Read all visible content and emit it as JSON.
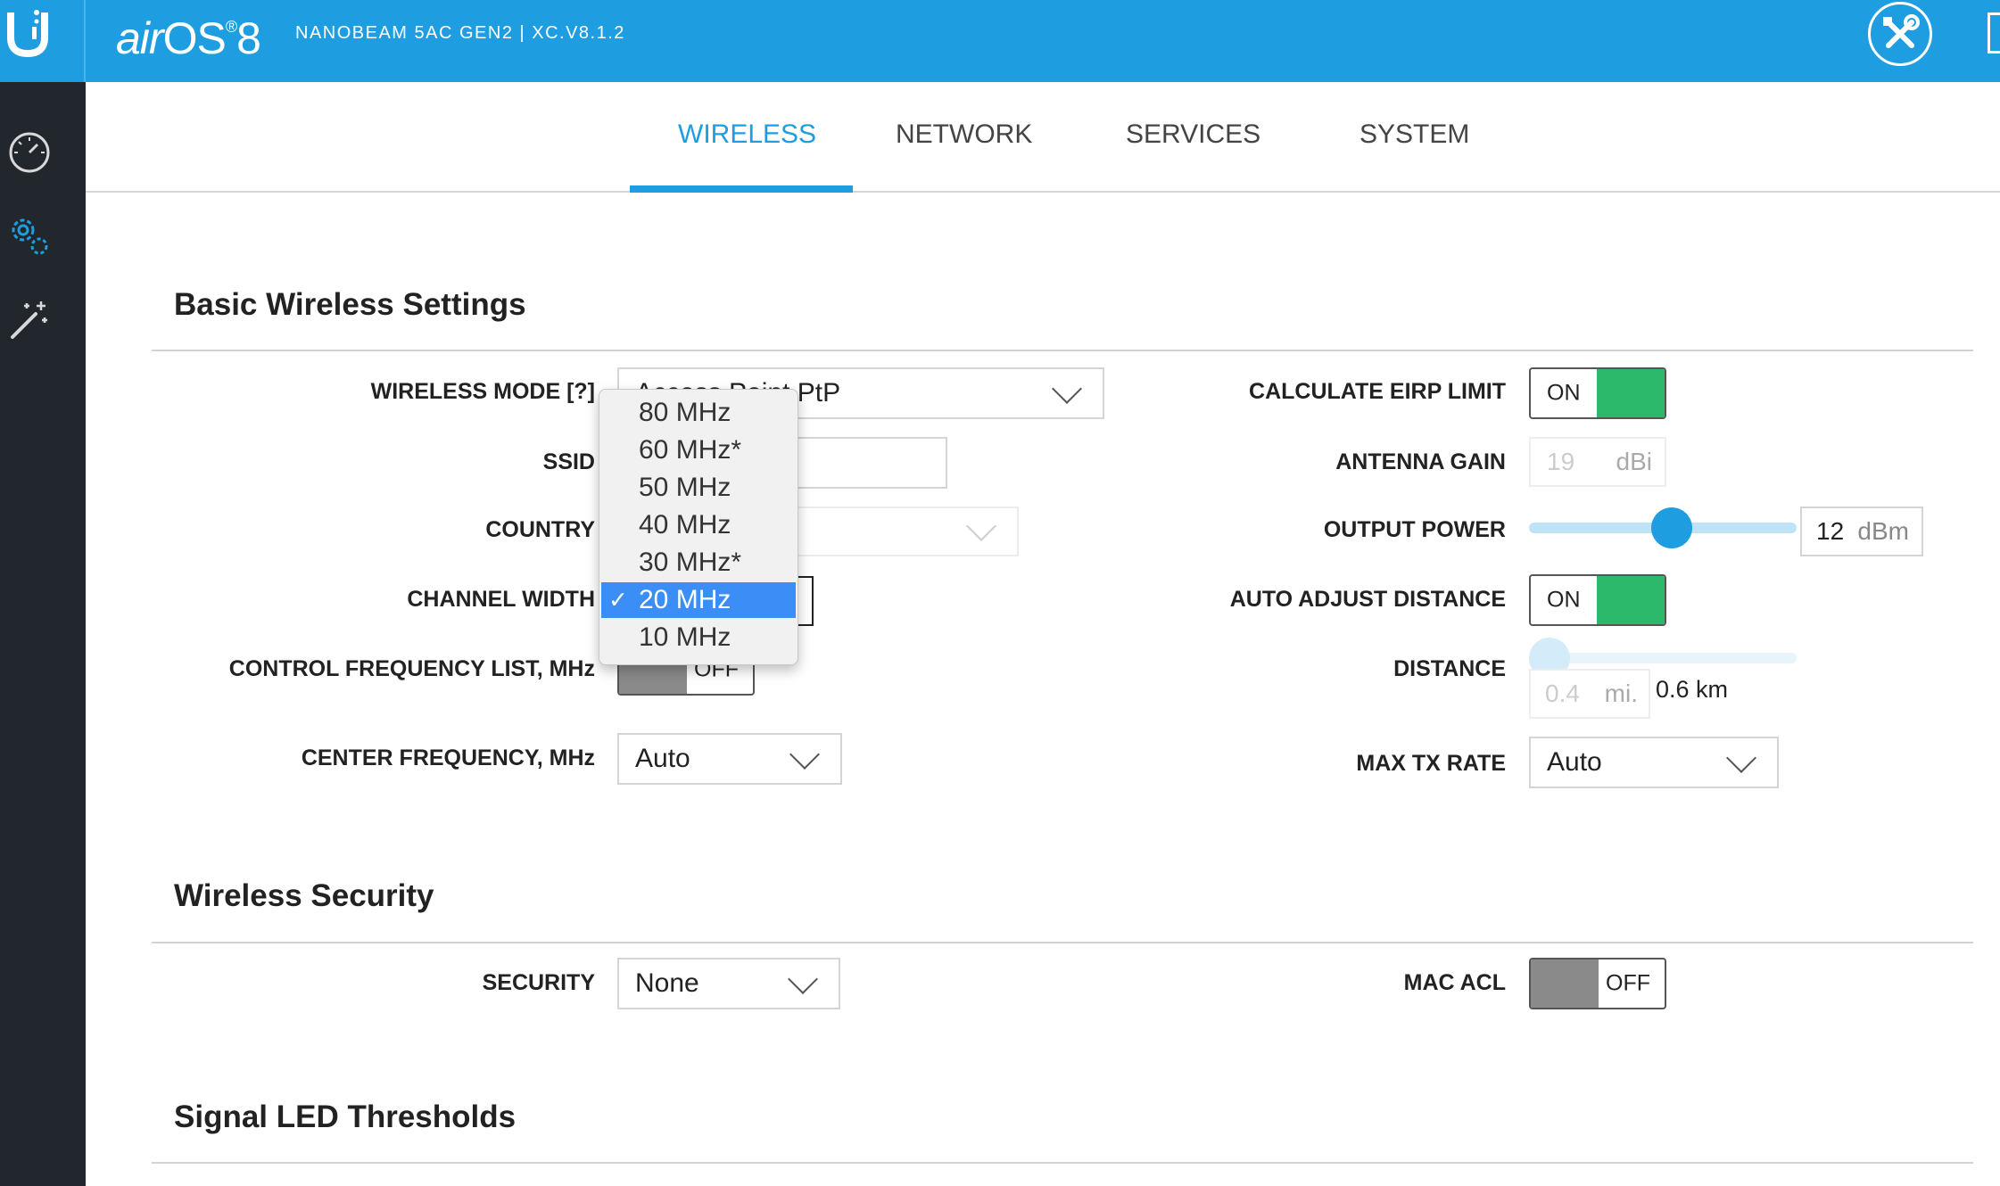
{
  "header": {
    "brand_air": "air",
    "brand_os": "OS",
    "brand_reg": "®",
    "brand_version": "8",
    "device": "NANOBEAM 5AC GEN2 | XC.V8.1.2"
  },
  "tabs": [
    {
      "label": "WIRELESS",
      "active": true
    },
    {
      "label": "NETWORK"
    },
    {
      "label": "SERVICES"
    },
    {
      "label": "SYSTEM"
    }
  ],
  "sections": {
    "basic": "Basic Wireless Settings",
    "security": "Wireless Security",
    "led": "Signal LED Thresholds"
  },
  "left": {
    "wireless_mode_label": "WIRELESS MODE [?]",
    "wireless_mode_value": "Access Point PtP",
    "ssid_label": "SSID",
    "country_label": "COUNTRY",
    "channel_width_label": "CHANNEL WIDTH",
    "control_freq_label": "CONTROL FREQUENCY LIST, MHz",
    "control_freq_toggle": "OFF",
    "center_freq_label": "CENTER FREQUENCY, MHz",
    "center_freq_value": "Auto"
  },
  "channel_width_dropdown": {
    "options": [
      "80 MHz",
      "60 MHz*",
      "50 MHz",
      "40 MHz",
      "30 MHz*",
      "20 MHz",
      "10 MHz"
    ],
    "selected_index": 5,
    "check": "✓"
  },
  "right": {
    "eirp_label": "CALCULATE EIRP LIMIT",
    "eirp_toggle": "ON",
    "gain_label": "ANTENNA GAIN",
    "gain_value": "19",
    "gain_unit": "dBi",
    "power_label": "OUTPUT POWER",
    "power_value": "12",
    "power_unit": "dBm",
    "power_level": 0.54,
    "auto_dist_label": "AUTO ADJUST DISTANCE",
    "auto_dist_toggle": "ON",
    "distance_label": "DISTANCE",
    "distance_value": "0.4",
    "distance_unit": "mi.",
    "distance_km": "0.6 km",
    "distance_level": 0.0,
    "max_tx_label": "MAX TX RATE",
    "max_tx_value": "Auto"
  },
  "security": {
    "security_label": "SECURITY",
    "security_value": "None",
    "mac_acl_label": "MAC ACL",
    "mac_acl_toggle": "OFF"
  },
  "colors": {
    "accent": "#1e9ee0",
    "sidebar": "#22272d",
    "toggle_on": "#2db96b",
    "toggle_off": "#8a8a8a",
    "dropdown_selection": "#3a8ef6"
  },
  "icons": {
    "logo": "ubiquiti-u-logo-icon",
    "tools": "tools-icon",
    "dashboard": "dashboard-gauge-icon",
    "settings": "gears-icon",
    "wizard": "magic-wand-icon"
  }
}
